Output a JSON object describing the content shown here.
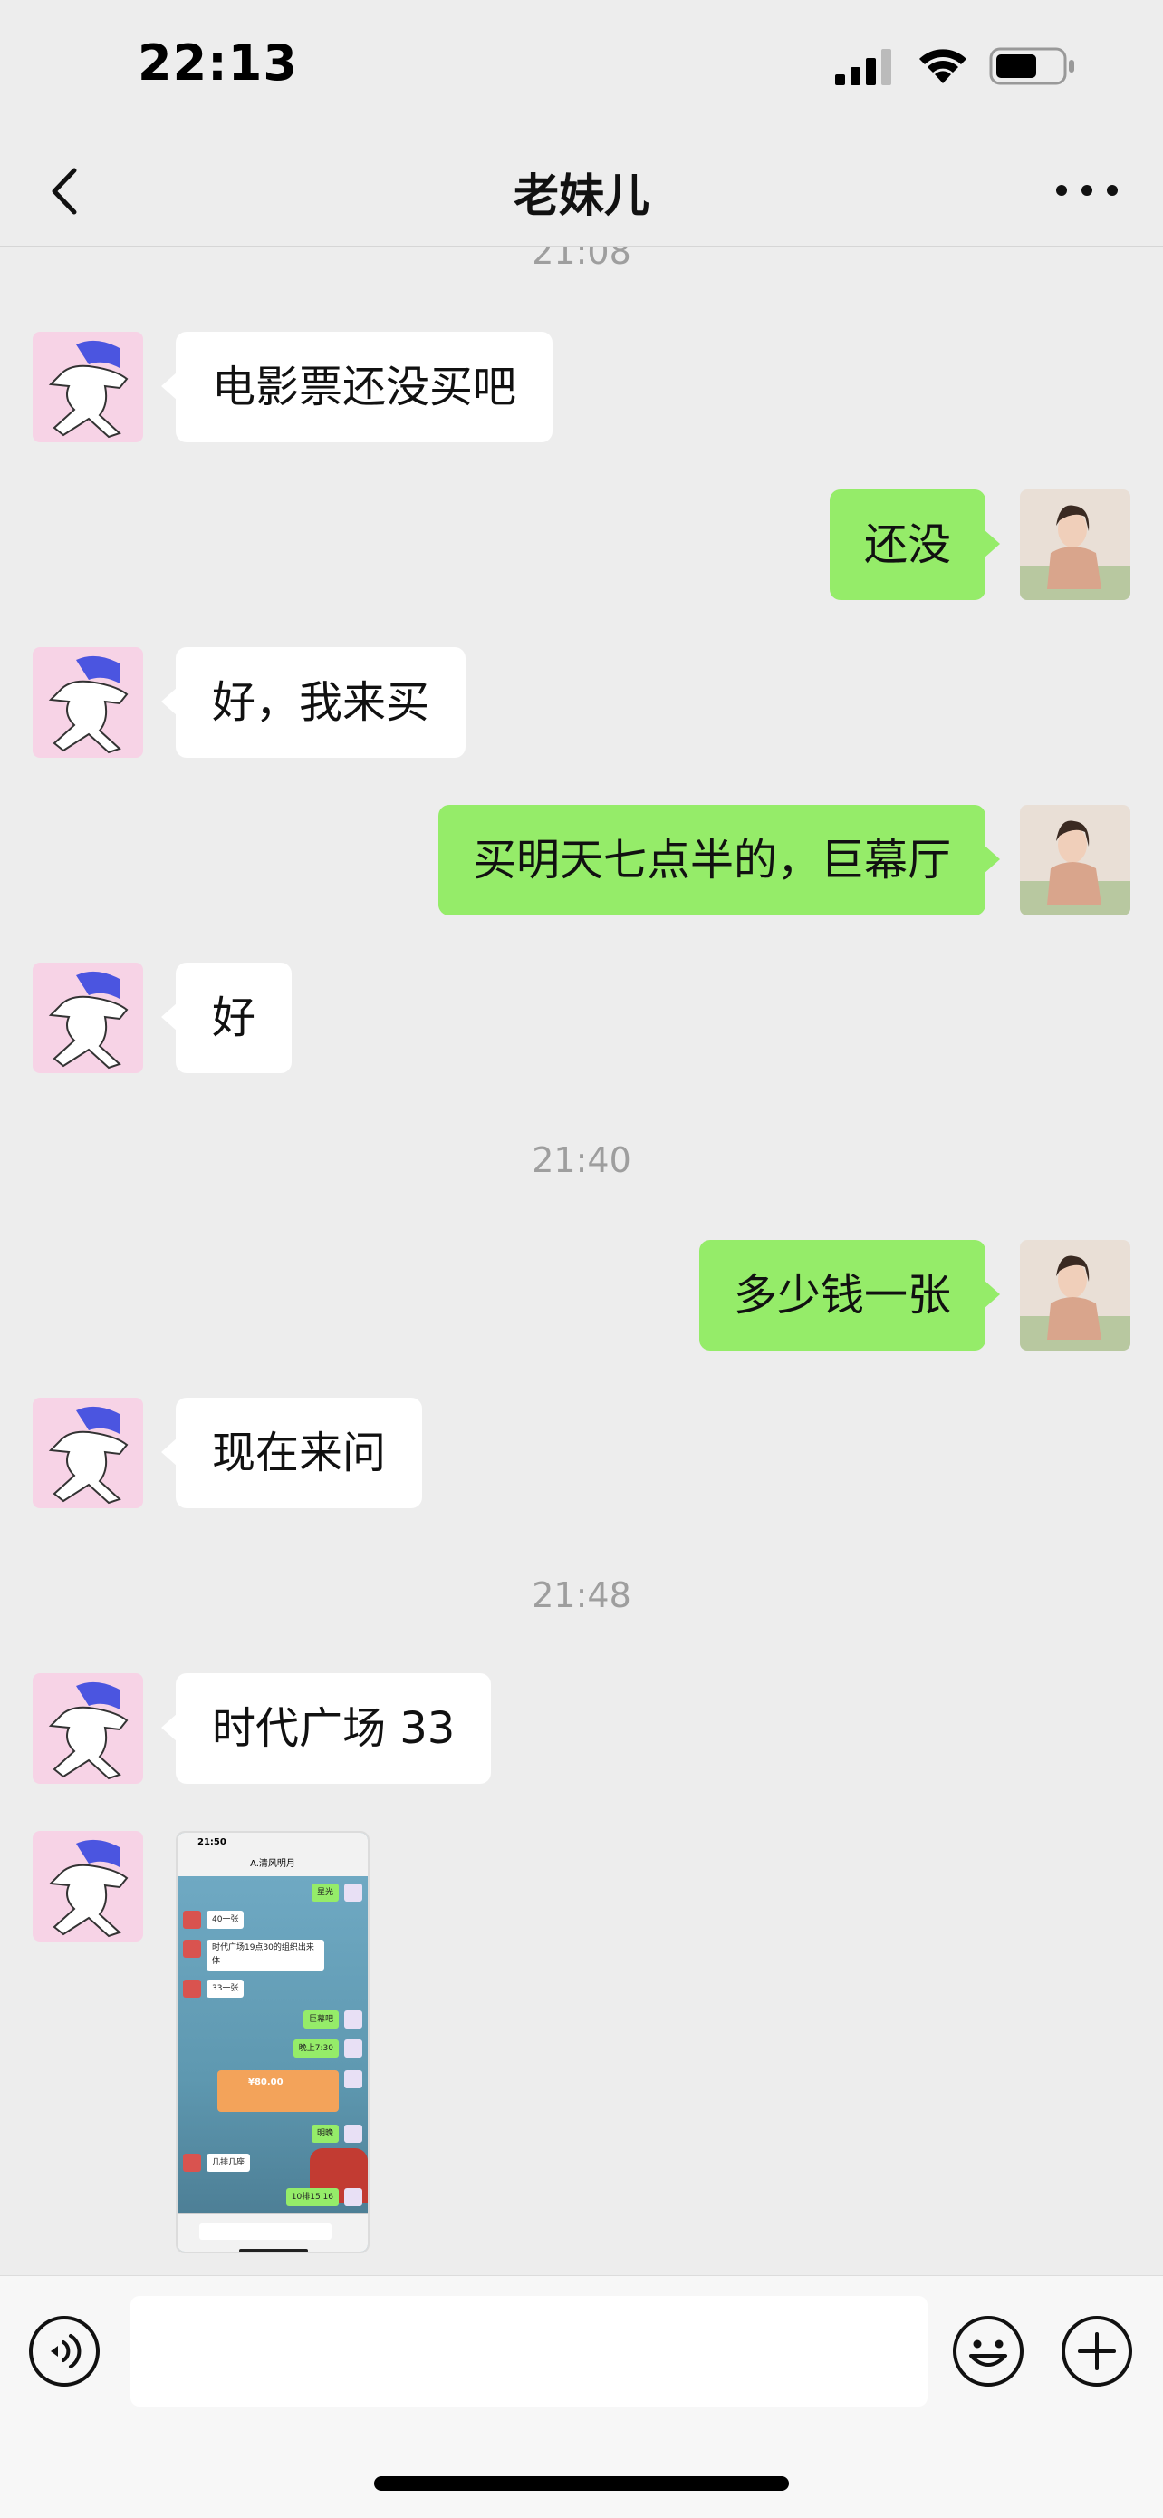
{
  "status_bar": {
    "time": "22:13"
  },
  "header": {
    "title": "老妹儿"
  },
  "messages": [
    {
      "type": "timestamp",
      "text": "21:08"
    },
    {
      "type": "text",
      "sender": "friend",
      "text": "电影票还没买吧"
    },
    {
      "type": "text",
      "sender": "me",
      "text": "还没"
    },
    {
      "type": "text",
      "sender": "friend",
      "text": "好，我来买"
    },
    {
      "type": "text",
      "sender": "me",
      "text": "买明天七点半的，巨幕厅"
    },
    {
      "type": "text",
      "sender": "friend",
      "text": "好"
    },
    {
      "type": "timestamp",
      "text": "21:40"
    },
    {
      "type": "text",
      "sender": "me",
      "text": "多少钱一张"
    },
    {
      "type": "text",
      "sender": "friend",
      "text": "现在来问"
    },
    {
      "type": "timestamp",
      "text": "21:48"
    },
    {
      "type": "text",
      "sender": "friend",
      "text": "时代广场 33"
    },
    {
      "type": "image",
      "sender": "friend"
    }
  ],
  "thumbnail": {
    "time": "21:50",
    "title": "A.清风明月",
    "bubbles": [
      {
        "side": "right",
        "text": "星光"
      },
      {
        "side": "left",
        "text": "40一张"
      },
      {
        "side": "left",
        "text": "时代广场19点30的组织出来体"
      },
      {
        "side": "left",
        "text": "33一张"
      },
      {
        "side": "right",
        "text": "巨幕吧"
      },
      {
        "side": "right",
        "text": "晚上7:30"
      },
      {
        "side": "right",
        "text": "明晚"
      },
      {
        "side": "left",
        "text": "几排几座"
      },
      {
        "side": "right",
        "text": "10排15 16"
      }
    ],
    "transfer_amount": "¥80.00"
  },
  "icons": {
    "back": "chevron-left-icon",
    "more": "more-dots-icon",
    "voice": "voice-icon",
    "emoji": "emoji-icon",
    "plus": "plus-icon"
  },
  "colors": {
    "background": "#ededed",
    "my_bubble": "#95ec69",
    "friend_bubble": "#ffffff",
    "timestamp": "#9e9e9e"
  }
}
